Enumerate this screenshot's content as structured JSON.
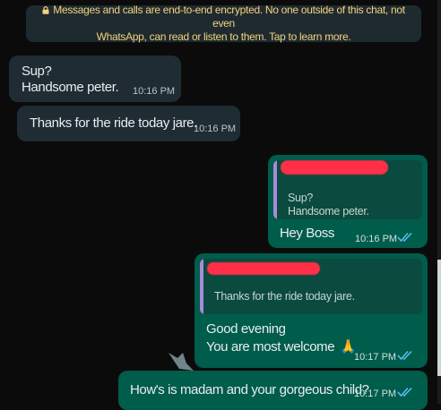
{
  "encryption_notice": {
    "line1": "Messages and calls are end-to-end encrypted. No one outside of this chat, not even",
    "line2": "WhatsApp, can read or listen to them. Tap to learn more."
  },
  "messages": [
    {
      "direction": "incoming",
      "lines": [
        "Sup?",
        "Handsome peter."
      ],
      "time": "10:16 PM"
    },
    {
      "direction": "incoming",
      "lines": [
        "Thanks for the ride today jare."
      ],
      "time": "10:16 PM"
    },
    {
      "direction": "outgoing",
      "quote": [
        "Sup?",
        "Handsome peter."
      ],
      "lines": [
        "Hey Boss"
      ],
      "time": "10:16 PM",
      "status": "read"
    },
    {
      "direction": "outgoing",
      "quote": [
        "Thanks for the ride today jare."
      ],
      "lines": [
        "Good evening",
        "You are most welcome"
      ],
      "emoji": "🙏",
      "time": "10:17 PM",
      "status": "read"
    },
    {
      "direction": "outgoing",
      "lines": [
        "How's is madam and your gorgeous child?"
      ],
      "time": "10:17 PM",
      "status": "read"
    }
  ],
  "colors": {
    "incoming": "#1f2c33",
    "outgoing": "#005c4b",
    "read_ticks": "#53bdeb",
    "notice_text": "#f1d37a"
  }
}
